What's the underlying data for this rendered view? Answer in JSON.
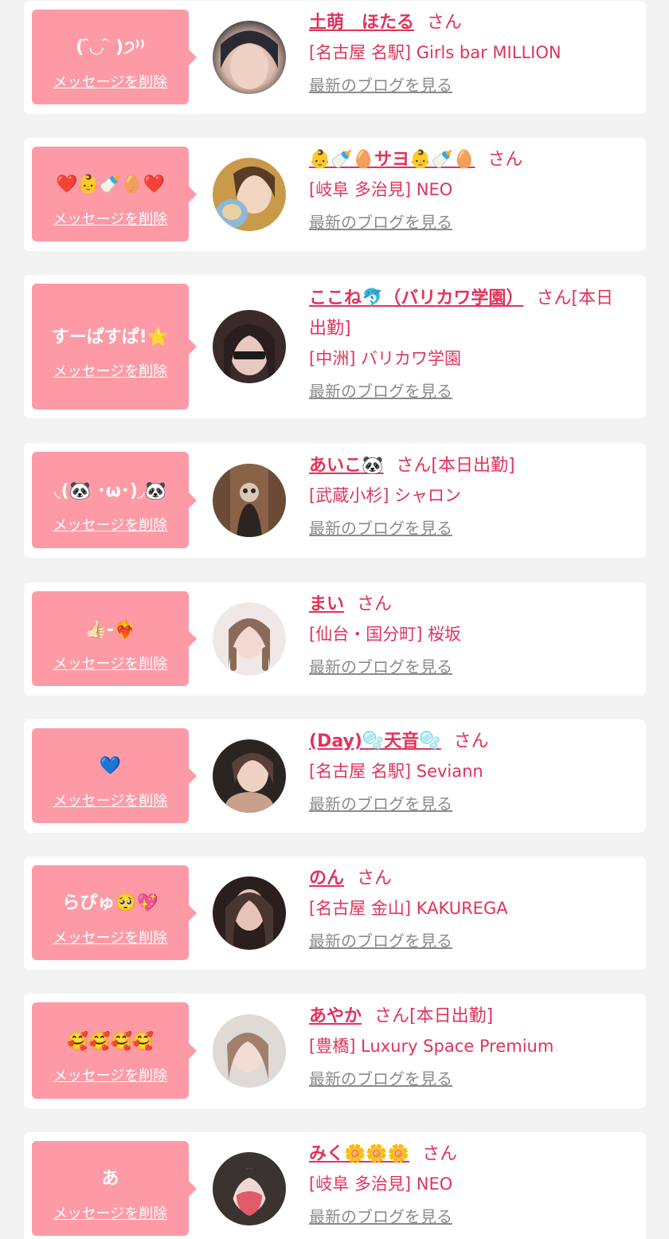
{
  "entries": [
    {
      "message": "(  ̑◡ ̑ )੭⁾⁾",
      "delete_label": "メッセージを削除",
      "name": "土萌　ほたる",
      "suffix": "さん",
      "shop": "[名古屋 名駅] Girls bar MILLION",
      "blog_label": "最新のブログを見る",
      "avatar_colors": [
        "#2b2a33",
        "#d9b7a8",
        "#f0d8cf"
      ]
    },
    {
      "message": "❤️👶🍼🥚❤️",
      "delete_label": "メッセージを削除",
      "name": "👶🍼🥚サヨ👶🍼🥚",
      "suffix": "さん",
      "shop": "[岐阜 多治見] NEO",
      "blog_label": "最新のブログを見る",
      "avatar_colors": [
        "#c99a4a",
        "#f1d6c2",
        "#8fb7d8"
      ]
    },
    {
      "message": "すーぱすぱ!⭐️",
      "delete_label": "メッセージを削除",
      "name": "ここね🐬（バリカワ学園）",
      "suffix": "さん[本日出勤]",
      "shop": "[中洲] バリカワ学園",
      "blog_label": "最新のブログを見る",
      "avatar_colors": [
        "#3a2a2a",
        "#e8c9bf",
        "#1a1a1a"
      ]
    },
    {
      "message": "◟(🐼 ･ω･)◞🐼",
      "delete_label": "メッセージを削除",
      "name": "あいこ🐼",
      "suffix": "さん[本日出勤]",
      "shop": "[武蔵小杉] シャロン",
      "blog_label": "最新のブログを見る",
      "avatar_colors": [
        "#6b4a36",
        "#2c2420",
        "#d8c7b4"
      ]
    },
    {
      "message": "👍🏻-❤️‍🔥",
      "delete_label": "メッセージを削除",
      "name": "まい",
      "suffix": "さん",
      "shop": "[仙台・国分町] 桜坂",
      "blog_label": "最新のブログを見る",
      "avatar_colors": [
        "#efe8e6",
        "#8a6a58",
        "#f4d9d2"
      ]
    },
    {
      "message": "💙",
      "delete_label": "メッセージを削除",
      "name": "(Day)🫧天音🫧",
      "suffix": "さん",
      "shop": "[名古屋 名駅] Seviann",
      "blog_label": "最新のブログを見る",
      "avatar_colors": [
        "#2a2523",
        "#c9a08c",
        "#efd2c4"
      ]
    },
    {
      "message": "らぴゅ🥺💖",
      "delete_label": "メッセージを削除",
      "name": "のん",
      "suffix": "さん",
      "shop": "[名古屋 金山] KAKUREGA",
      "blog_label": "最新のブログを見る",
      "avatar_colors": [
        "#2a1f1d",
        "#e7c3b6",
        "#4a3631"
      ]
    },
    {
      "message": "🥰🥰🥰🥰",
      "delete_label": "メッセージを削除",
      "name": "あやか",
      "suffix": "さん[本日出勤]",
      "shop": "[豊橋] Luxury Space Premium",
      "blog_label": "最新のブログを見る",
      "avatar_colors": [
        "#dedad6",
        "#a27f6c",
        "#f3dcd3"
      ]
    },
    {
      "message": "あ",
      "delete_label": "メッセージを削除",
      "name": "みく🌼🌼🌼",
      "suffix": "さん",
      "shop": "[岐阜 多治見] NEO",
      "blog_label": "最新のブログを見る",
      "avatar_colors": [
        "#3b3330",
        "#e05a6a",
        "#f0d8d2"
      ]
    }
  ],
  "colors": {
    "background": "#f3f3f3",
    "card": "#ffffff",
    "bubble": "#fd9aa6",
    "accent_text": "#e0335c",
    "blog_link": "#8b8b8b"
  }
}
